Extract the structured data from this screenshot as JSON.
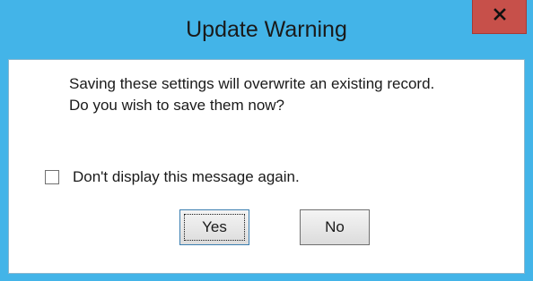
{
  "dialog": {
    "title": "Update Warning",
    "close_label": "x",
    "message_line1": "Saving these settings will overwrite an existing record.",
    "message_line2": "Do you wish to save them now?",
    "checkbox_label": "Don't display this message again.",
    "checkbox_checked": false,
    "yes_label": "Yes",
    "no_label": "No",
    "colors": {
      "frame": "#43b4e8",
      "close_button": "#c7504a"
    }
  }
}
